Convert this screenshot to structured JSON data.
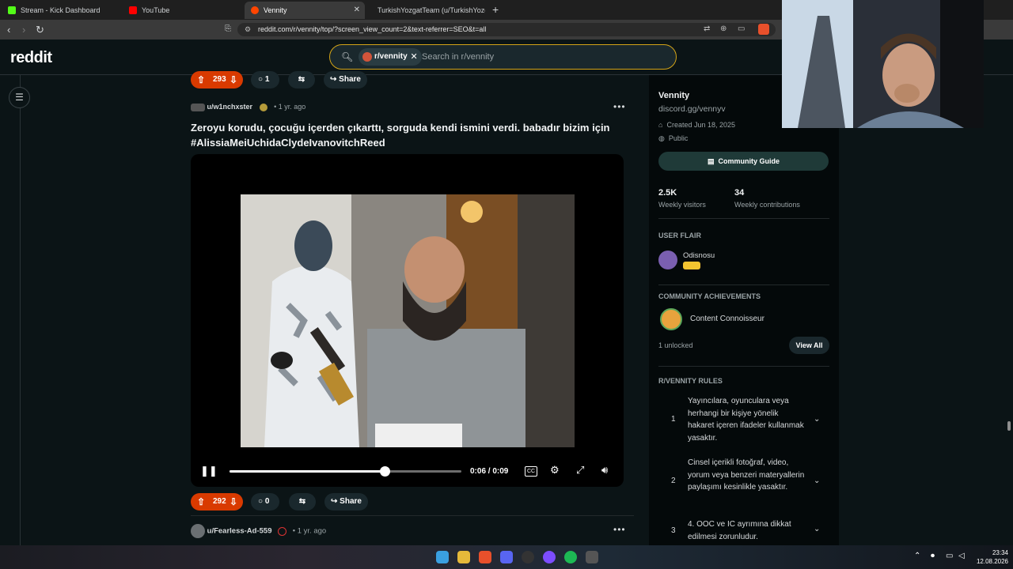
{
  "browser": {
    "tabs": [
      {
        "label": "Stream - Kick Dashboard",
        "color": "#53fc18"
      },
      {
        "label": "YouTube",
        "color": "#ff0000"
      },
      {
        "label": "Vennity",
        "color": "#ff4500"
      },
      {
        "label": "TurkishYozgatTeam (u/TurkishYozgat",
        "color": "#ff4500"
      }
    ],
    "url": "reddit.com/r/vennity/top/?screen_view_count=2&text-referrer=SEO&t=all"
  },
  "reddit": {
    "logo": "reddit",
    "search": {
      "community": "r/vennity",
      "placeholder": "Search in r/vennity"
    }
  },
  "prev_post_actions": {
    "votes": "293",
    "comments": "1",
    "share": "Share"
  },
  "post": {
    "user": "u/w1nchxster",
    "age": "1 yr. ago",
    "title": "Zeroyu korudu, çocuğu içerden çıkarttı, sorguda kendi ismini verdi. babadır bizim için #AlissiaMeiUchidaClydeIvanovitchReed",
    "video": {
      "time": "0:06 / 0:09",
      "progress": 0.67
    },
    "votes": "292",
    "comments": "0",
    "share": "Share"
  },
  "next_post": {
    "user": "u/Fearless-Ad-559",
    "age": "1 yr. ago"
  },
  "sidebar": {
    "name": "Vennity",
    "link": "discord.gg/vennyv",
    "created": "Created Jun 18, 2025",
    "visibility": "Public",
    "guide_button": "Community Guide",
    "stats": [
      {
        "value": "2.5K",
        "label": "Weekly visitors"
      },
      {
        "value": "34",
        "label": "Weekly contributions"
      }
    ],
    "user_flair_heading": "USER FLAIR",
    "flair_name": "Odisnosu",
    "achievements_heading": "COMMUNITY ACHIEVEMENTS",
    "achievement": "Content Connoisseur",
    "unlocked": "1 unlocked",
    "view_all": "View All",
    "rules_heading": "R/VENNITY RULES",
    "rules": [
      {
        "n": "1",
        "text": "Yayıncılara, oyunculara veya herhangi bir kişiye yönelik hakaret içeren ifadeler kullanmak yasaktır."
      },
      {
        "n": "2",
        "text": "Cinsel içerikli fotoğraf, video, yorum veya benzeri materyallerin paylaşımı kesinlikle yasaktır."
      },
      {
        "n": "3",
        "text": "4. OOC ve IC ayrımına dikkat edilmesi zorunludur."
      }
    ]
  },
  "taskbar": {
    "time": "23:34",
    "date": "12.08.2026"
  }
}
